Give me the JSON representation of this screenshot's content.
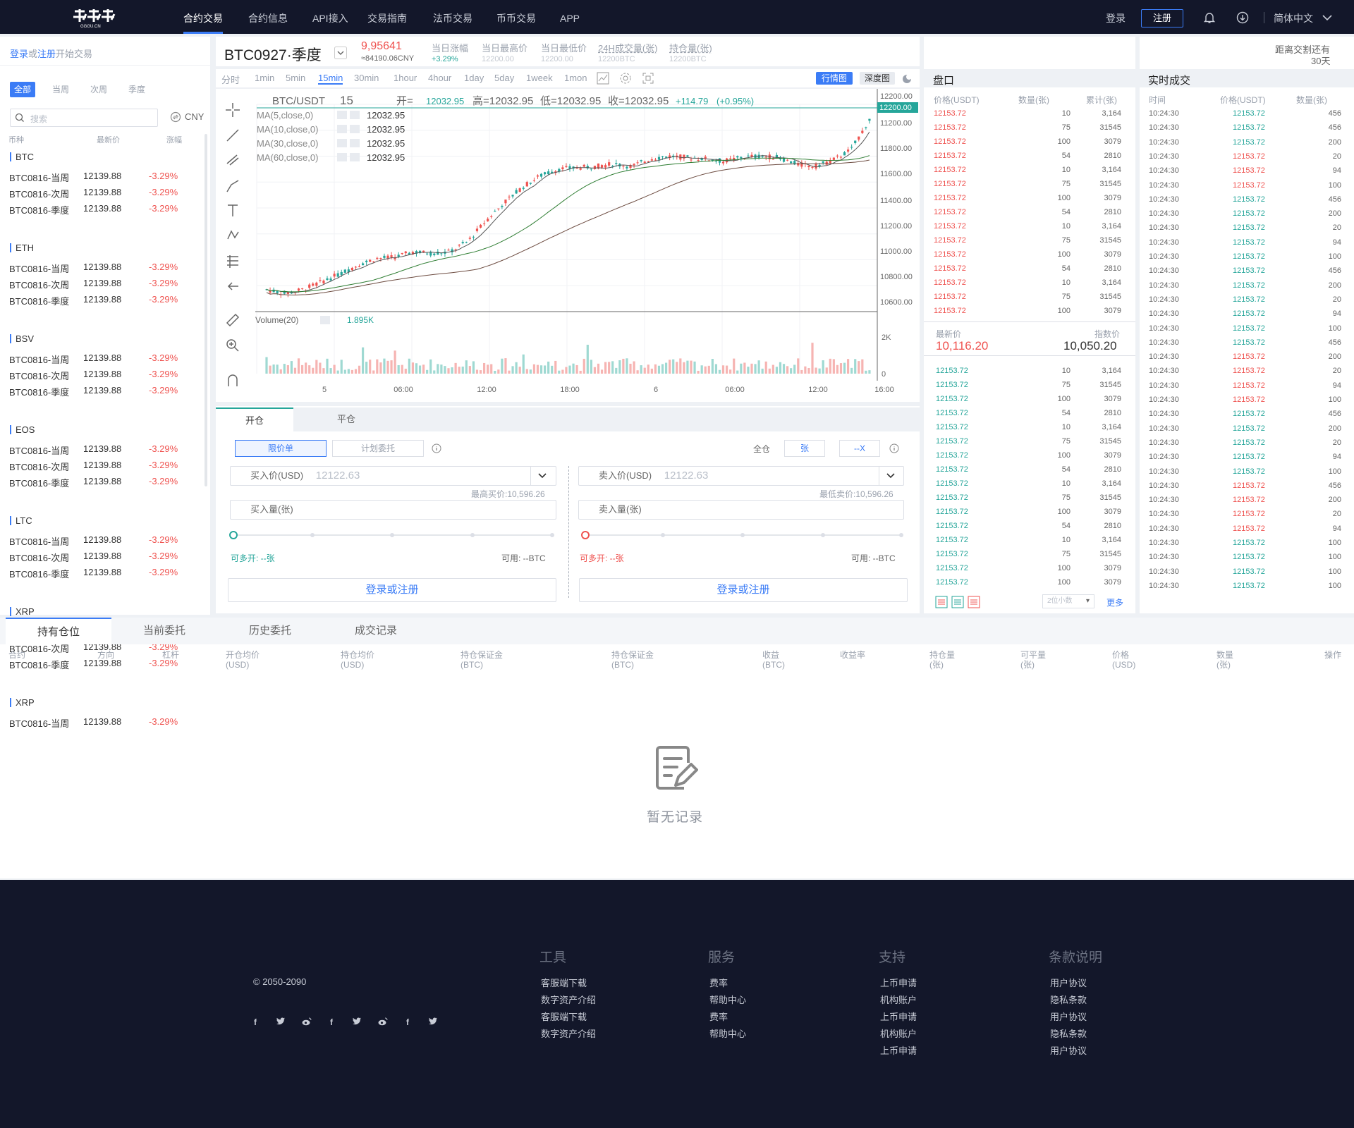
{
  "nav": {
    "items": [
      "合约交易",
      "合约信息",
      "API接入",
      "交易指南",
      "法币交易",
      "币币交易",
      "APP"
    ],
    "active": 0,
    "login": "登录",
    "register": "注册",
    "language": "简体中文"
  },
  "sidebar": {
    "login_link": "登录",
    "or": "或",
    "register_link": "注册",
    "start": "开始交易",
    "filters": [
      "全部",
      "当周",
      "次周",
      "季度"
    ],
    "search_placeholder": "搜索",
    "currency": "CNY",
    "col_coin": "币种",
    "col_price": "最新价",
    "col_change": "涨幅",
    "groups": [
      {
        "name": "BTC",
        "rows": [
          {
            "name": "BTC0816-当周",
            "price": "12139.88",
            "change": "-3.29%"
          },
          {
            "name": "BTC0816-次周",
            "price": "12139.88",
            "change": "-3.29%"
          },
          {
            "name": "BTC0816-季度",
            "price": "12139.88",
            "change": "-3.29%"
          }
        ]
      },
      {
        "name": "ETH",
        "rows": [
          {
            "name": "BTC0816-当周",
            "price": "12139.88",
            "change": "-3.29%"
          },
          {
            "name": "BTC0816-次周",
            "price": "12139.88",
            "change": "-3.29%"
          },
          {
            "name": "BTC0816-季度",
            "price": "12139.88",
            "change": "-3.29%"
          }
        ]
      },
      {
        "name": "BSV",
        "rows": [
          {
            "name": "BTC0816-当周",
            "price": "12139.88",
            "change": "-3.29%"
          },
          {
            "name": "BTC0816-次周",
            "price": "12139.88",
            "change": "-3.29%"
          },
          {
            "name": "BTC0816-季度",
            "price": "12139.88",
            "change": "-3.29%"
          }
        ]
      },
      {
        "name": "EOS",
        "rows": [
          {
            "name": "BTC0816-当周",
            "price": "12139.88",
            "change": "-3.29%"
          },
          {
            "name": "BTC0816-次周",
            "price": "12139.88",
            "change": "-3.29%"
          },
          {
            "name": "BTC0816-季度",
            "price": "12139.88",
            "change": "-3.29%"
          }
        ]
      },
      {
        "name": "LTC",
        "rows": [
          {
            "name": "BTC0816-当周",
            "price": "12139.88",
            "change": "-3.29%"
          },
          {
            "name": "BTC0816-次周",
            "price": "12139.88",
            "change": "-3.29%"
          },
          {
            "name": "BTC0816-季度",
            "price": "12139.88",
            "change": "-3.29%"
          }
        ]
      },
      {
        "name": "XRP",
        "rows": [
          {
            "name": "BTC0816-当周",
            "price": "12139.88",
            "change": "-3.29%"
          },
          {
            "name": "BTC0816-次周",
            "price": "12139.88",
            "change": "-3.29%"
          },
          {
            "name": "BTC0816-季度",
            "price": "12139.88",
            "change": "-3.29%"
          }
        ]
      },
      {
        "name": "XRP",
        "rows": [
          {
            "name": "BTC0816-当周",
            "price": "12139.88",
            "change": "-3.29%"
          }
        ]
      }
    ]
  },
  "ticker": {
    "symbol": "BTC0927·季度",
    "price": "9,95641",
    "cny": "≈84190.06CNY",
    "stats": [
      {
        "label": "当日涨幅",
        "value": "+3.29%"
      },
      {
        "label": "当日最高价",
        "value": "12200.00"
      },
      {
        "label": "当日最低价",
        "value": "12200.00"
      },
      {
        "label": "24H成交量(张)",
        "value": "12200BTC"
      },
      {
        "label": "持仓量(张)",
        "value": "12200BTC"
      }
    ]
  },
  "chart_tools": {
    "timeframes": [
      "分时",
      "1min",
      "5min",
      "15min",
      "30min",
      "1hour",
      "4hour",
      "1day",
      "5day",
      "1week",
      "1mon"
    ],
    "active_tf": "15min",
    "mode_kline": "行情图",
    "mode_depth": "深度图"
  },
  "chart_data": {
    "type": "candlestick",
    "pair": "BTC/USDT",
    "interval": "15",
    "ohlc_text": {
      "open": "开=",
      "open_v": "12032.95",
      "high": "高=12032.95",
      "low": "低=12032.95",
      "close": "收=12032.95",
      "chg": "+114.79",
      "pct": "(+0.95%)"
    },
    "ma": [
      {
        "label": "MA(5,close,0)",
        "value": "12032.95"
      },
      {
        "label": "MA(10,close,0)",
        "value": "12032.95"
      },
      {
        "label": "MA(30,close,0)",
        "value": "12032.95"
      },
      {
        "label": "MA(60,close,0)",
        "value": "12032.95"
      }
    ],
    "y_ticks": [
      "12200.00",
      "11200.00",
      "11800.00",
      "11600.00",
      "11400.00",
      "11200.00",
      "11000.00",
      "10800.00",
      "10600.00"
    ],
    "last_price_tag": "12200.00",
    "volume_label": "Volume(20)",
    "volume_value": "1.895K",
    "volume_ticks": [
      "2K",
      "0"
    ],
    "x_ticks": [
      "5",
      "06:00",
      "12:00",
      "18:00",
      "6",
      "06:00",
      "12:00",
      "16:00"
    ],
    "ylim": [
      10600,
      12200
    ],
    "trend": [
      10770,
      10740,
      10770,
      10830,
      10890,
      10960,
      11010,
      11020,
      11060,
      11050,
      11060,
      11140,
      11300,
      11440,
      11560,
      11650,
      11700,
      11710,
      11720,
      11740,
      11720,
      11780,
      11800,
      11790,
      11780,
      11760,
      11790,
      11800,
      11790,
      11740,
      11720,
      11770,
      11850,
      12080
    ]
  },
  "trade": {
    "tabs": [
      "开仓",
      "平仓"
    ],
    "order_types": [
      "限价单",
      "计划委托"
    ],
    "margin_mode": "全仓",
    "unit": "张",
    "leverage": "--X",
    "buy_price_label": "买入价(USD)",
    "buy_price_value": "12122.63",
    "buy_hint": "最高买价:10,596.26",
    "buy_qty_label": "买入量(张)",
    "buy_can": "可多开: --张",
    "buy_avail": "可用: --BTC",
    "sell_price_label": "卖入价(USD)",
    "sell_price_value": "12122.63",
    "sell_hint": "最低卖价:10,596.26",
    "sell_qty_label": "卖入量(张)",
    "sell_can": "可多开: --张",
    "sell_avail": "可用: --BTC",
    "login_btn": "登录或注册"
  },
  "orderbook": {
    "title": "盘口",
    "col_price": "价格(USDT)",
    "col_qty": "数量(张)",
    "col_total": "累计(张)",
    "asks": [
      [
        "12153.72",
        "10",
        "3,164"
      ],
      [
        "12153.72",
        "75",
        "31545"
      ],
      [
        "12153.72",
        "100",
        "3079"
      ],
      [
        "12153.72",
        "54",
        "2810"
      ],
      [
        "12153.72",
        "10",
        "3,164"
      ],
      [
        "12153.72",
        "75",
        "31545"
      ],
      [
        "12153.72",
        "100",
        "3079"
      ],
      [
        "12153.72",
        "54",
        "2810"
      ],
      [
        "12153.72",
        "10",
        "3,164"
      ],
      [
        "12153.72",
        "75",
        "31545"
      ],
      [
        "12153.72",
        "100",
        "3079"
      ],
      [
        "12153.72",
        "54",
        "2810"
      ],
      [
        "12153.72",
        "10",
        "3,164"
      ],
      [
        "12153.72",
        "75",
        "31545"
      ],
      [
        "12153.72",
        "100",
        "3079"
      ]
    ],
    "last_label": "最新价",
    "last_value": "10,116.20",
    "index_label": "指数价",
    "index_value": "10,050.20",
    "bids": [
      [
        "12153.72",
        "10",
        "3,164"
      ],
      [
        "12153.72",
        "75",
        "31545"
      ],
      [
        "12153.72",
        "100",
        "3079"
      ],
      [
        "12153.72",
        "54",
        "2810"
      ],
      [
        "12153.72",
        "10",
        "3,164"
      ],
      [
        "12153.72",
        "75",
        "31545"
      ],
      [
        "12153.72",
        "100",
        "3079"
      ],
      [
        "12153.72",
        "54",
        "2810"
      ],
      [
        "12153.72",
        "10",
        "3,164"
      ],
      [
        "12153.72",
        "75",
        "31545"
      ],
      [
        "12153.72",
        "100",
        "3079"
      ],
      [
        "12153.72",
        "54",
        "2810"
      ],
      [
        "12153.72",
        "10",
        "3,164"
      ],
      [
        "12153.72",
        "75",
        "31545"
      ],
      [
        "12153.72",
        "100",
        "3079"
      ],
      [
        "12153.72",
        "100",
        "3079"
      ]
    ],
    "decimals": "2位小数",
    "more": "更多"
  },
  "trades": {
    "countdown_label": "距离交割还有",
    "countdown_value": "30天",
    "title": "实时成交",
    "col_time": "时间",
    "col_price": "价格(USDT)",
    "col_qty": "数量(张)",
    "rows": [
      [
        "10:24:30",
        "12153.72",
        "456",
        "g"
      ],
      [
        "10:24:30",
        "12153.72",
        "456",
        "g"
      ],
      [
        "10:24:30",
        "12153.72",
        "200",
        "g"
      ],
      [
        "10:24:30",
        "12153.72",
        "20",
        "r"
      ],
      [
        "10:24:30",
        "12153.72",
        "94",
        "r"
      ],
      [
        "10:24:30",
        "12153.72",
        "100",
        "r"
      ],
      [
        "10:24:30",
        "12153.72",
        "456",
        "g"
      ],
      [
        "10:24:30",
        "12153.72",
        "200",
        "g"
      ],
      [
        "10:24:30",
        "12153.72",
        "20",
        "g"
      ],
      [
        "10:24:30",
        "12153.72",
        "94",
        "g"
      ],
      [
        "10:24:30",
        "12153.72",
        "100",
        "g"
      ],
      [
        "10:24:30",
        "12153.72",
        "456",
        "g"
      ],
      [
        "10:24:30",
        "12153.72",
        "200",
        "g"
      ],
      [
        "10:24:30",
        "12153.72",
        "20",
        "g"
      ],
      [
        "10:24:30",
        "12153.72",
        "94",
        "g"
      ],
      [
        "10:24:30",
        "12153.72",
        "100",
        "g"
      ],
      [
        "10:24:30",
        "12153.72",
        "456",
        "g"
      ],
      [
        "10:24:30",
        "12153.72",
        "200",
        "r"
      ],
      [
        "10:24:30",
        "12153.72",
        "20",
        "r"
      ],
      [
        "10:24:30",
        "12153.72",
        "94",
        "r"
      ],
      [
        "10:24:30",
        "12153.72",
        "100",
        "r"
      ],
      [
        "10:24:30",
        "12153.72",
        "456",
        "g"
      ],
      [
        "10:24:30",
        "12153.72",
        "200",
        "g"
      ],
      [
        "10:24:30",
        "12153.72",
        "20",
        "g"
      ],
      [
        "10:24:30",
        "12153.72",
        "94",
        "g"
      ],
      [
        "10:24:30",
        "12153.72",
        "100",
        "g"
      ],
      [
        "10:24:30",
        "12153.72",
        "456",
        "r"
      ],
      [
        "10:24:30",
        "12153.72",
        "200",
        "r"
      ],
      [
        "10:24:30",
        "12153.72",
        "20",
        "r"
      ],
      [
        "10:24:30",
        "12153.72",
        "94",
        "r"
      ],
      [
        "10:24:30",
        "12153.72",
        "100",
        "g"
      ],
      [
        "10:24:30",
        "12153.72",
        "100",
        "g"
      ],
      [
        "10:24:30",
        "12153.72",
        "100",
        "g"
      ],
      [
        "10:24:30",
        "12153.72",
        "100",
        "g"
      ]
    ]
  },
  "positions": {
    "tabs": [
      "持有仓位",
      "当前委托",
      "历史委托",
      "成交记录"
    ],
    "columns": [
      [
        "合约",
        ""
      ],
      [
        "方向",
        ""
      ],
      [
        "杠杆",
        ""
      ],
      [
        "开仓均价",
        "(USD)"
      ],
      [
        "持仓均价",
        "(USD)"
      ],
      [
        "持仓保证金",
        "(BTC)"
      ],
      [
        "持仓保证金",
        "(BTC)"
      ],
      [
        "收益",
        "(BTC)"
      ],
      [
        "收益率",
        ""
      ],
      [
        "持仓量",
        "(张)"
      ],
      [
        "可平量",
        "(张)"
      ],
      [
        "价格",
        "(USD)"
      ],
      [
        "数量",
        "(张)"
      ],
      [
        "操作",
        ""
      ]
    ],
    "empty": "暂无记录"
  },
  "footer": {
    "copyright": "© 2050-2090",
    "social": [
      "f",
      "twitter",
      "weibo",
      "f",
      "twitter",
      "weibo",
      "f",
      "twitter"
    ],
    "cols": [
      {
        "title": "工具",
        "links": [
          "客服端下载",
          "数字资产介绍",
          "客服端下载",
          "数字资产介绍"
        ]
      },
      {
        "title": "服务",
        "links": [
          "费率",
          "帮助中心",
          "费率",
          "帮助中心"
        ]
      },
      {
        "title": "支持",
        "links": [
          "上币申请",
          "机构账户",
          "上币申请",
          "机构账户",
          "上币申请"
        ]
      },
      {
        "title": "条款说明",
        "links": [
          "用户协议",
          "隐私条款",
          "用户协议",
          "隐私条款",
          "用户协议"
        ]
      }
    ]
  },
  "colors": {
    "up": "#26a69a",
    "down": "#ef5350",
    "accent": "#3b7cf6",
    "nav_bg": "#13172a"
  }
}
